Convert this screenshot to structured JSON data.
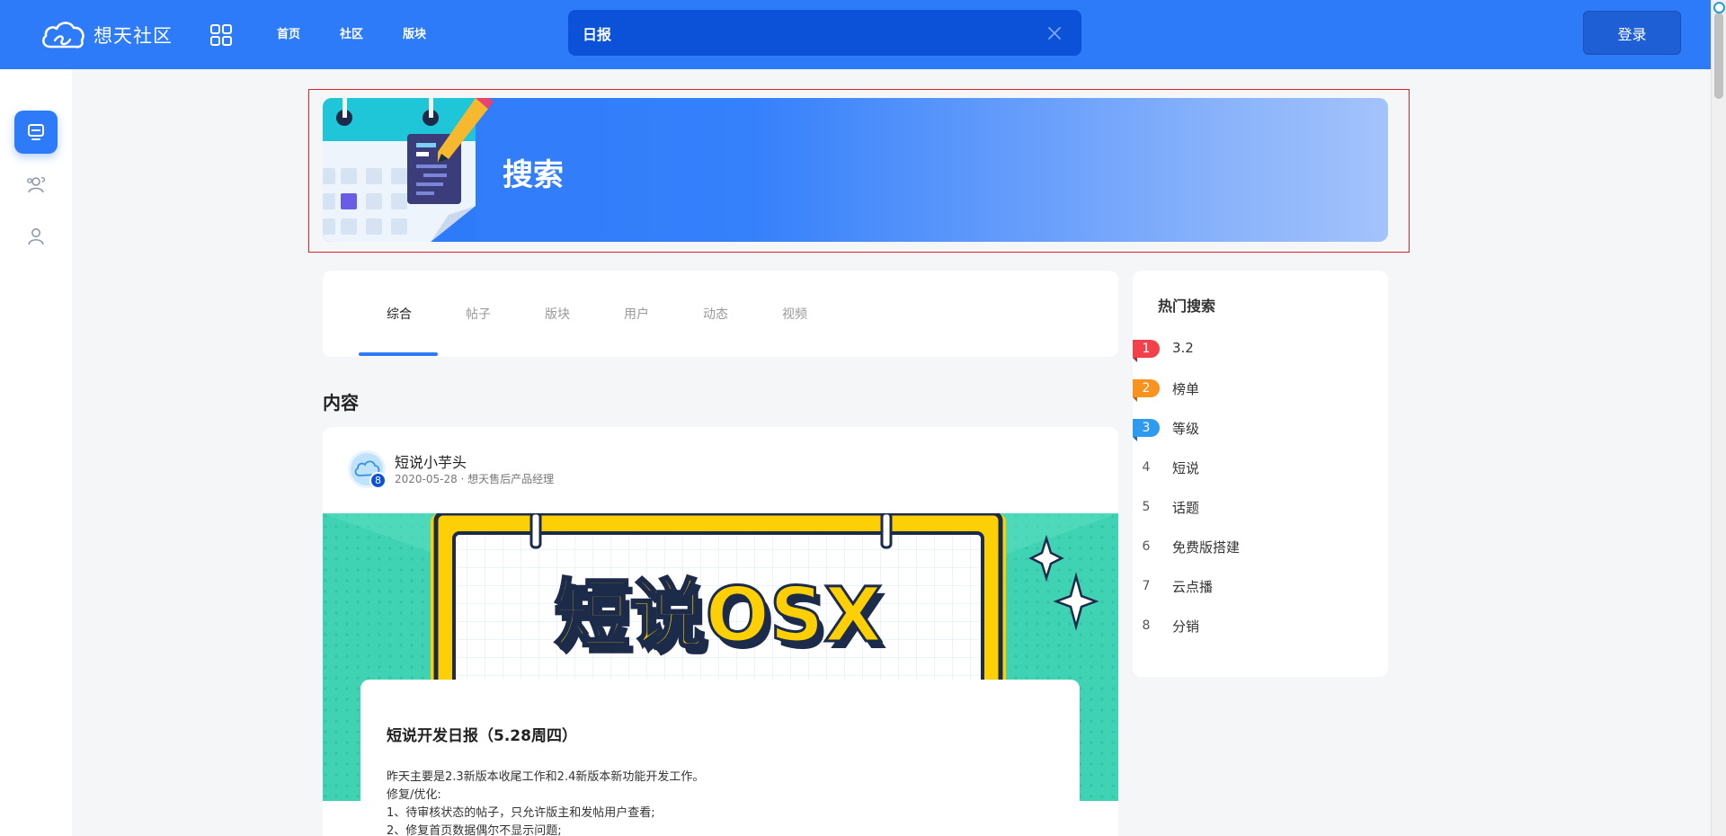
{
  "header": {
    "logo_text": "想天社区",
    "nav": [
      "首页",
      "社区",
      "版块"
    ],
    "search_value": "日报",
    "login_label": "登录"
  },
  "sidebar": {
    "items": [
      {
        "icon": "monitor-icon",
        "active": true
      },
      {
        "icon": "users-icon",
        "active": false
      },
      {
        "icon": "user-icon",
        "active": false
      }
    ]
  },
  "banner": {
    "title": "搜索"
  },
  "tabs": [
    "综合",
    "帖子",
    "版块",
    "用户",
    "动态",
    "视频"
  ],
  "active_tab": "综合",
  "section_title": "内容",
  "post": {
    "author": "短说小芋头",
    "badge": "8",
    "meta": "2020-05-28 · 想天售后产品经理",
    "image_text": "短说OSX",
    "title": "短说开发日报（5.28周四）",
    "lines": [
      "昨天主要是2.3新版本收尾工作和2.4新版本新功能开发工作。",
      "修复/优化:",
      "1、待审核状态的帖子，只允许版主和发帖用户查看;",
      "2、修复首页数据偶尔不显示问题;"
    ]
  },
  "hot_search": {
    "title": "热门搜索",
    "items": [
      {
        "rank": "1",
        "label": "3.2",
        "color": "#f2414b"
      },
      {
        "rank": "2",
        "label": "榜单",
        "color": "#f7931e"
      },
      {
        "rank": "3",
        "label": "等级",
        "color": "#2e9bf0"
      },
      {
        "rank": "4",
        "label": "短说"
      },
      {
        "rank": "5",
        "label": "话题"
      },
      {
        "rank": "6",
        "label": "免费版搭建"
      },
      {
        "rank": "7",
        "label": "云点播"
      },
      {
        "rank": "8",
        "label": "分销"
      }
    ]
  },
  "colors": {
    "primary": "#2e7bf9",
    "header_search_bg": "#0b52d8"
  }
}
